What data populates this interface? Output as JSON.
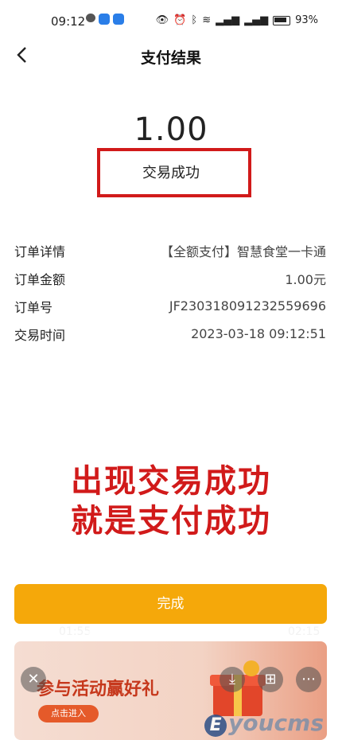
{
  "status": {
    "time": "09:12",
    "battery": "93%"
  },
  "nav": {
    "back_icon": "chevron-left-icon",
    "title": "支付结果"
  },
  "result": {
    "amount": "1.00",
    "status_text": "交易成功"
  },
  "details": [
    {
      "label": "订单详情",
      "value": "【全额支付】智慧食堂一卡通"
    },
    {
      "label": "订单金额",
      "value": "1.00元"
    },
    {
      "label": "订单号",
      "value": "JF230318091232559696"
    },
    {
      "label": "交易时间",
      "value": "2023-03-18 09:12:51"
    }
  ],
  "annotation": {
    "line1": "出现交易成功",
    "line2": "就是支付成功"
  },
  "done_button": {
    "label": "完成"
  },
  "video": {
    "current": "01:55",
    "total": "02:15",
    "progress": 0.88
  },
  "ad": {
    "title": "参与活动赢好礼",
    "cta": "点击进入"
  },
  "watermark": {
    "text": "youcms",
    "badge": "E"
  },
  "colors": {
    "accent": "#f5a80a",
    "alert_red": "#d11a1a"
  }
}
